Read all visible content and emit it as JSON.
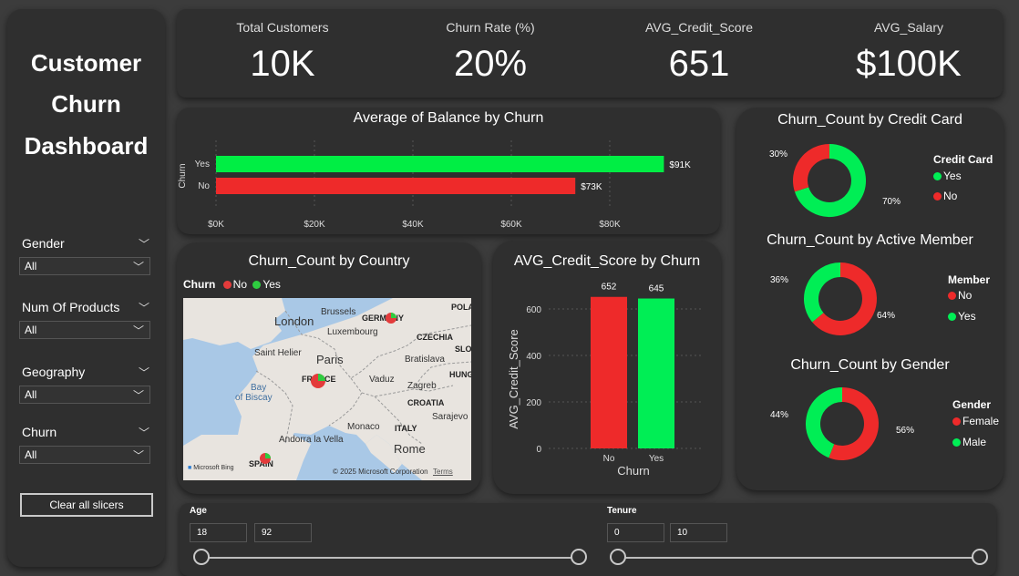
{
  "sidebar": {
    "title_lines": [
      "Customer",
      "Churn",
      "Dashboard"
    ],
    "slicers": [
      {
        "label": "Gender",
        "value": "All"
      },
      {
        "label": "Num Of Products",
        "value": "All"
      },
      {
        "label": "Geography",
        "value": "All"
      },
      {
        "label": "Churn",
        "value": "All"
      }
    ],
    "clear_label": "Clear all slicers"
  },
  "kpis": [
    {
      "label": "Total Customers",
      "value": "10K"
    },
    {
      "label": "Churn Rate (%)",
      "value": "20%"
    },
    {
      "label": "AVG_Credit_Score",
      "value": "651"
    },
    {
      "label": "AVG_Salary",
      "value": "$100K"
    }
  ],
  "balance_chart": {
    "title": "Average of Balance by Churn",
    "ylabel": "Churn",
    "categories": [
      "Yes",
      "No"
    ],
    "values": [
      91000,
      73000
    ],
    "data_labels": [
      "$91K",
      "$73K"
    ],
    "ticks": [
      "$0K",
      "$20K",
      "$40K",
      "$60K",
      "$80K"
    ],
    "colors": {
      "Yes": "#00ee44",
      "No": "#ee2a2a"
    }
  },
  "country_map": {
    "title": "Churn_Count by Country",
    "legend_title": "Churn",
    "legend": [
      {
        "label": "No",
        "color": "#e33b3b"
      },
      {
        "label": "Yes",
        "color": "#2ecc40"
      }
    ],
    "places": [
      "London",
      "Brussels",
      "Luxembourg",
      "Paris",
      "Saint Helier",
      "Bay",
      "of Biscay",
      "Vaduz",
      "Bratislava",
      "Zagreb",
      "Sarajevo",
      "Monaco",
      "Andorra la Vella",
      "Rome"
    ],
    "countries": [
      "GERMANY",
      "FRANCE",
      "SPAIN",
      "ITALY",
      "CZECHIA",
      "CROATIA",
      "POLA",
      "SLOV",
      "HUNG"
    ],
    "copyright": "© 2025 Microsoft Corporation",
    "terms": "Terms",
    "brand": "Microsoft Bing"
  },
  "credit_chart": {
    "title": "AVG_Credit_Score by Churn",
    "xlabel": "Churn",
    "ylabel": "AVG_Credit_Score",
    "categories": [
      "No",
      "Yes"
    ],
    "values": [
      652,
      645
    ],
    "ticks": [
      "0",
      "200",
      "400",
      "600"
    ],
    "ylim": [
      0,
      700
    ],
    "colors": [
      "#ee2a2a",
      "#00ee55"
    ]
  },
  "donut_credit": {
    "title": "Churn_Count by Credit Card",
    "legend_title": "Credit Card",
    "legend": [
      "Yes",
      "No"
    ],
    "slices": [
      {
        "label": "Yes",
        "value": 70,
        "text": "70%",
        "color": "#00ee55"
      },
      {
        "label": "No",
        "value": 30,
        "text": "30%",
        "color": "#ee2a2a"
      }
    ]
  },
  "donut_member": {
    "title": "Churn_Count by Active Member",
    "legend_title": "Member",
    "legend": [
      "No",
      "Yes"
    ],
    "slices": [
      {
        "label": "No",
        "value": 64,
        "text": "64%",
        "color": "#ee2a2a"
      },
      {
        "label": "Yes",
        "value": 36,
        "text": "36%",
        "color": "#00ee55"
      }
    ]
  },
  "donut_gender": {
    "title": "Churn_Count by Gender",
    "legend_title": "Gender",
    "legend": [
      "Female",
      "Male"
    ],
    "slices": [
      {
        "label": "Female",
        "value": 56,
        "text": "56%",
        "color": "#ee2a2a"
      },
      {
        "label": "Male",
        "value": 44,
        "text": "44%",
        "color": "#00ee55"
      }
    ]
  },
  "sliders": {
    "age": {
      "label": "Age",
      "min": "18",
      "max": "92"
    },
    "tenure": {
      "label": "Tenure",
      "min": "0",
      "max": "10"
    }
  },
  "chart_data": [
    {
      "type": "bar",
      "title": "Average of Balance by Churn",
      "categories": [
        "Yes",
        "No"
      ],
      "values": [
        91000,
        73000
      ],
      "ylabel": "Churn",
      "xlim": [
        0,
        93000
      ]
    },
    {
      "type": "bar",
      "title": "AVG_Credit_Score by Churn",
      "categories": [
        "No",
        "Yes"
      ],
      "values": [
        652,
        645
      ],
      "xlabel": "Churn",
      "ylabel": "AVG_Credit_Score",
      "ylim": [
        0,
        700
      ]
    },
    {
      "type": "pie",
      "title": "Churn_Count by Credit Card",
      "categories": [
        "Yes",
        "No"
      ],
      "values": [
        70,
        30
      ]
    },
    {
      "type": "pie",
      "title": "Churn_Count by Active Member",
      "categories": [
        "No",
        "Yes"
      ],
      "values": [
        64,
        36
      ]
    },
    {
      "type": "pie",
      "title": "Churn_Count by Gender",
      "categories": [
        "Female",
        "Male"
      ],
      "values": [
        56,
        44
      ]
    }
  ]
}
